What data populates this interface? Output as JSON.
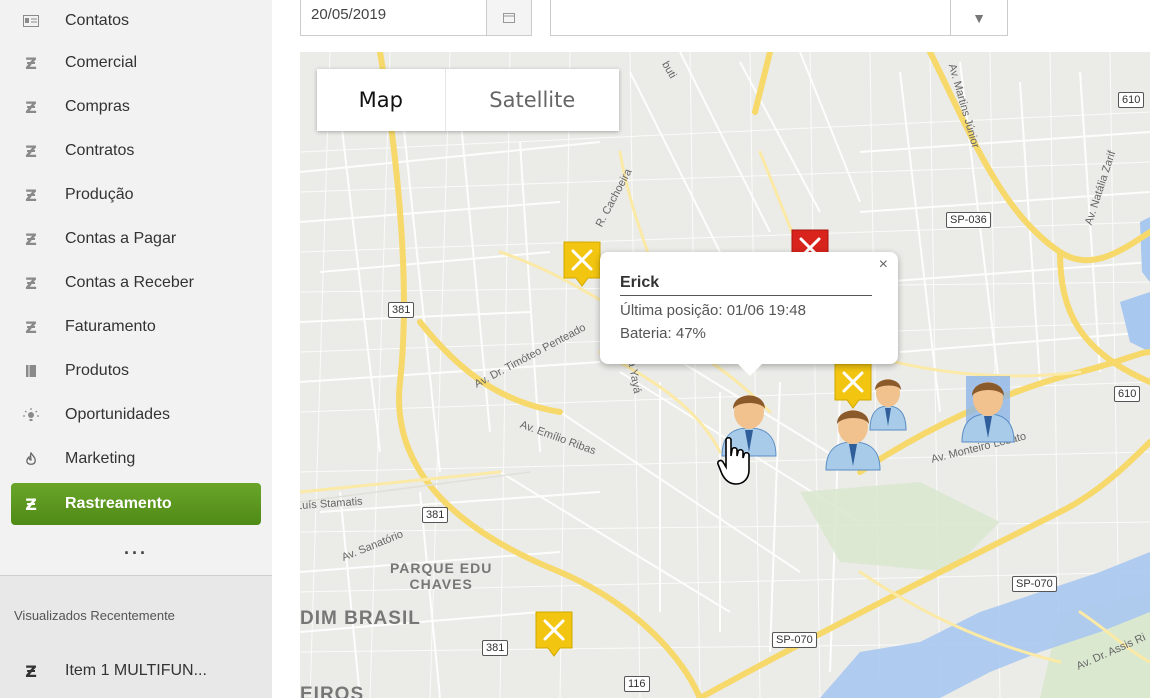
{
  "sidebar": {
    "items": [
      {
        "label": "Contatos",
        "icon": "contact-card-icon",
        "active": false
      },
      {
        "label": "Comercial",
        "icon": "z-logo-icon",
        "active": false
      },
      {
        "label": "Compras",
        "icon": "z-logo-icon",
        "active": false
      },
      {
        "label": "Contratos",
        "icon": "z-logo-icon",
        "active": false
      },
      {
        "label": "Produção",
        "icon": "z-logo-icon",
        "active": false
      },
      {
        "label": "Contas a Pagar",
        "icon": "z-logo-icon",
        "active": false
      },
      {
        "label": "Contas a Receber",
        "icon": "z-logo-icon",
        "active": false
      },
      {
        "label": "Faturamento",
        "icon": "z-logo-icon",
        "active": false
      },
      {
        "label": "Produtos",
        "icon": "book-icon",
        "active": false
      },
      {
        "label": "Oportunidades",
        "icon": "lightbulb-icon",
        "active": false
      },
      {
        "label": "Marketing",
        "icon": "flame-icon",
        "active": false
      },
      {
        "label": "Rastreamento",
        "icon": "z-logo-icon",
        "active": true
      }
    ],
    "more": "...",
    "recent_title": "Visualizados Recentemente",
    "recent_items": [
      {
        "label": "Item 1 MULTIFUN...",
        "icon": "z-logo-icon"
      }
    ]
  },
  "filters": {
    "date_value": "20/05/2019",
    "select_value": ""
  },
  "map": {
    "type_control": {
      "map_label": "Map",
      "satellite_label": "Satellite",
      "selected": "Map"
    },
    "popup": {
      "name": "Erick",
      "last_position": "Última posição: 01/06 19:48",
      "battery": "Bateria: 47%",
      "close": "×"
    },
    "shields": [
      "610",
      "610",
      "SP-036",
      "381",
      "381",
      "381",
      "SP-070",
      "SP-070",
      "116"
    ],
    "streets": [
      "Av. Dr. Timóteo Penteado",
      "Av. Emílio Ribas",
      "R. Cachoeira",
      "da Yayá",
      "Av. Monteiro Lobato",
      "Av. Martins Júnior",
      "Av. Natália Zarif",
      "Luís Stamatis",
      "Av. Sanatório",
      "Av. Dr. Assis Ri",
      "buti"
    ],
    "areas": [
      "PARQUE EDU\nCHAVES",
      "DIM BRASIL",
      "EIROS"
    ]
  }
}
